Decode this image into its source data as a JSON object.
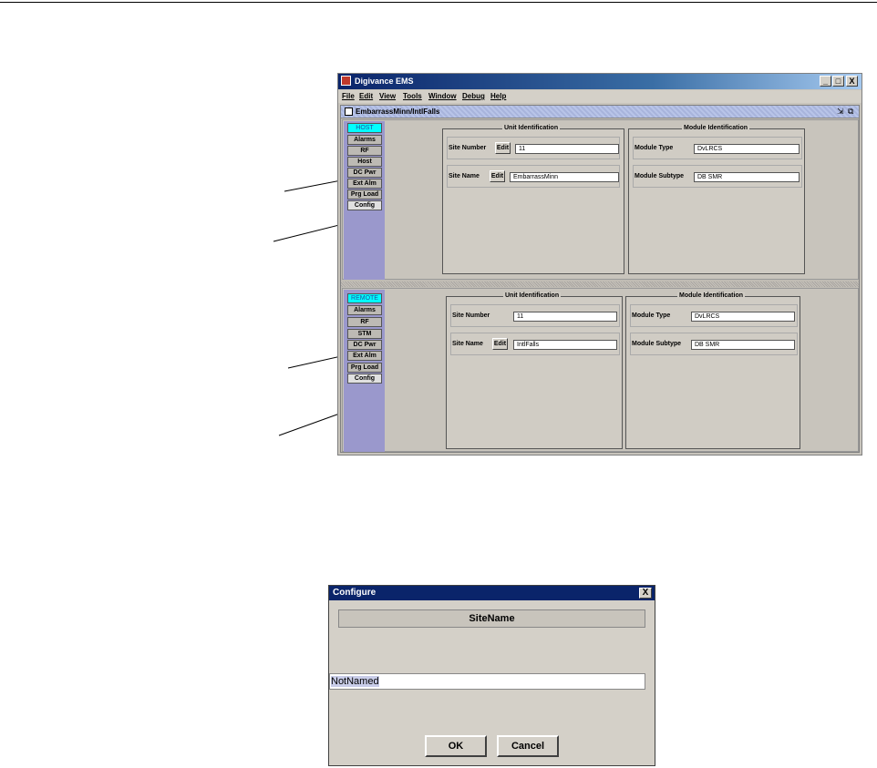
{
  "window": {
    "title": "Digivance EMS",
    "controls": [
      "_",
      "□",
      "X"
    ],
    "menus": [
      "File",
      "Edit",
      "View",
      "Tools",
      "Window",
      "Debug",
      "Help"
    ],
    "inner_title": "EmbarrassMinn/IntlFalls"
  },
  "host": {
    "header": "HOST",
    "nav": [
      "Alarms",
      "RF",
      "Host",
      "DC Pwr",
      "Ext Alm",
      "Prg Load",
      "Config"
    ],
    "unit_id": {
      "title": "Unit Identification",
      "site_number_label": "Site Number",
      "edit_label": "Edit",
      "site_number": "11",
      "site_name_label": "Site Name",
      "site_name": "EmbarrassMinn"
    },
    "module_id": {
      "title": "Module Identification",
      "module_type_label": "Module Type",
      "module_type": "DvLRCS",
      "module_subtype_label": "Module Subtype",
      "module_subtype": "DB SMR"
    }
  },
  "remote": {
    "header": "REMOTE",
    "nav": [
      "Alarms",
      "RF",
      "STM",
      "DC Pwr",
      "Ext Alm",
      "Prg Load",
      "Config"
    ],
    "unit_id": {
      "title": "Unit Identification",
      "site_number_label": "Site Number",
      "edit_label": "Edit",
      "site_number": "11",
      "site_name_label": "Site Name",
      "site_name": "IntlFalls"
    },
    "module_id": {
      "title": "Module Identification",
      "module_type_label": "Module Type",
      "module_type": "DvLRCS",
      "module_subtype_label": "Module Subtype",
      "module_subtype": "DB SMR"
    }
  },
  "dialog": {
    "title": "Configure",
    "close": "X",
    "header": "SiteName",
    "value": "NotNamed",
    "ok_label": "OK",
    "cancel_label": "Cancel"
  }
}
